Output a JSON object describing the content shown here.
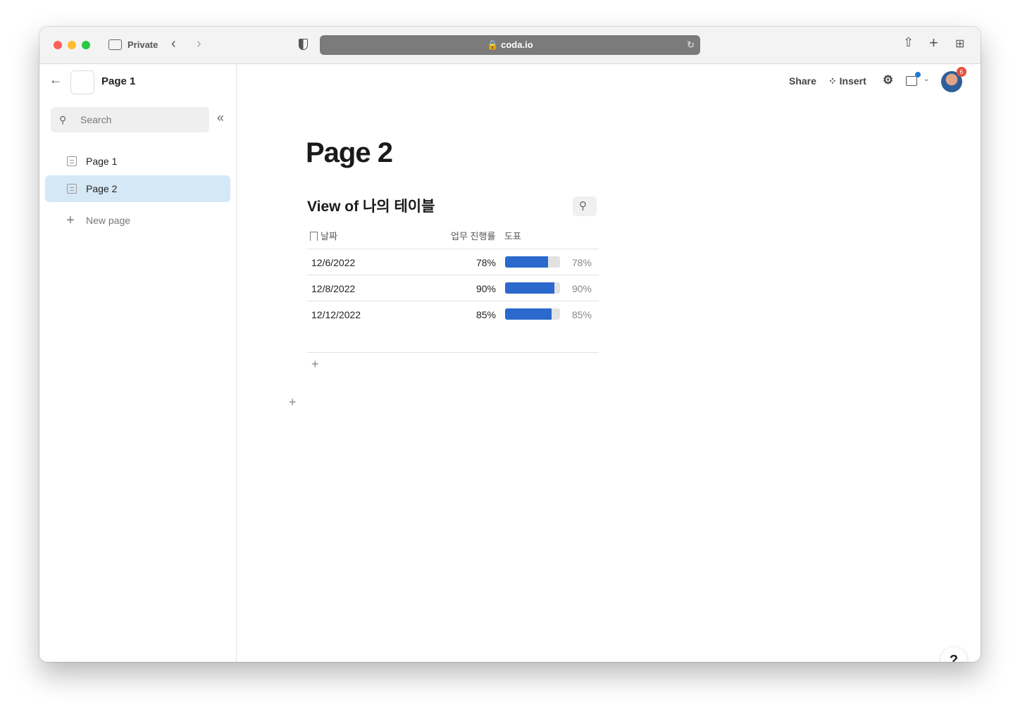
{
  "browser": {
    "private_label": "Private",
    "url": "coda.io"
  },
  "sidebar": {
    "doc_title": "Page 1",
    "search_placeholder": "Search",
    "pages": [
      {
        "label": "Page 1"
      },
      {
        "label": "Page 2",
        "selected": true
      }
    ],
    "new_page": "New page"
  },
  "toolbar": {
    "share": "Share",
    "insert": "Insert",
    "notification_count": "6"
  },
  "page": {
    "title": "Page 2"
  },
  "table": {
    "title": "View of 나의 테이블",
    "columns": [
      "날짜",
      "업무 진행률",
      "도표"
    ],
    "rows": [
      {
        "date": "12/6/2022",
        "progress": "78%",
        "value": 78
      },
      {
        "date": "12/8/2022",
        "progress": "90%",
        "value": 90
      },
      {
        "date": "12/12/2022",
        "progress": "85%",
        "value": 85
      }
    ]
  },
  "help": "?",
  "colors": {
    "accent": "#2b69cc",
    "selected": "#d5e8f6"
  }
}
